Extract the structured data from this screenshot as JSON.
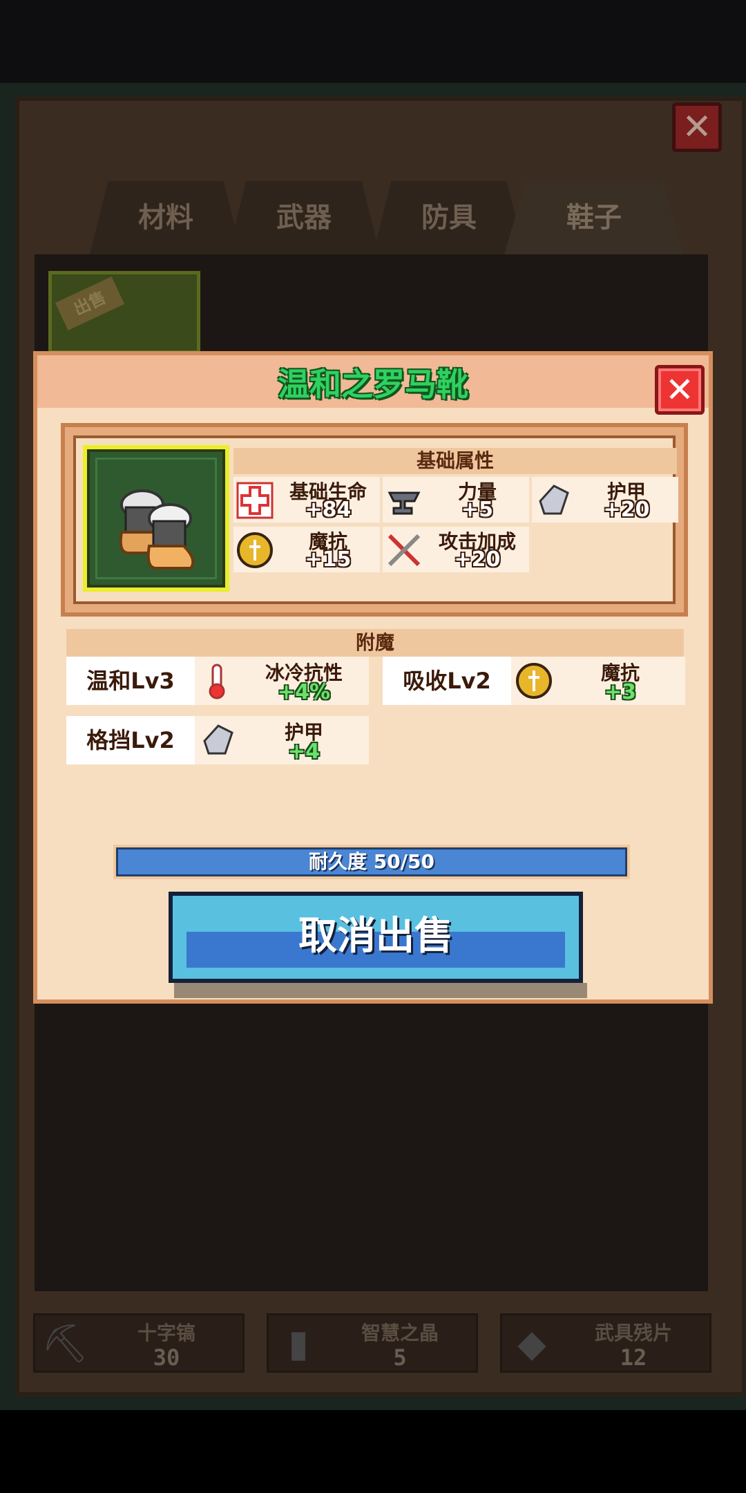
{
  "tabs": [
    "材料",
    "武器",
    "防具",
    "鞋子"
  ],
  "inventory": {
    "sell_tag": "出售"
  },
  "resources": [
    {
      "name": "十字镐",
      "value": "30",
      "icon": "pickaxe-icon"
    },
    {
      "name": "智慧之晶",
      "value": "5",
      "icon": "crystal-icon"
    },
    {
      "name": "武具残片",
      "value": "12",
      "icon": "fragment-icon"
    }
  ],
  "modal": {
    "title": "温和之罗马靴",
    "base_attr_title": "基础属性",
    "attrs": [
      {
        "name": "基础生命",
        "value": "+84",
        "icon": "health-cross-icon"
      },
      {
        "name": "力量",
        "value": "+5",
        "icon": "anvil-icon"
      },
      {
        "name": "护甲",
        "value": "+20",
        "icon": "armor-shard-icon"
      },
      {
        "name": "魔抗",
        "value": "+15",
        "icon": "magic-resist-icon"
      },
      {
        "name": "攻击加成",
        "value": "+20",
        "icon": "crossed-swords-icon"
      }
    ],
    "enchant_title": "附魔",
    "enchants": [
      {
        "name": "温和Lv3",
        "stat": "冰冷抗性",
        "value": "+4%",
        "icon": "thermometer-icon"
      },
      {
        "name": "吸收Lv2",
        "stat": "魔抗",
        "value": "+3",
        "icon": "magic-resist-icon"
      },
      {
        "name": "格挡Lv2",
        "stat": "护甲",
        "value": "+4",
        "icon": "armor-shard-icon"
      }
    ],
    "durability": {
      "label": "耐久度 50/50",
      "current": 50,
      "max": 50
    },
    "button_label": "取消出售"
  },
  "colors": {
    "title_green": "#2fd15e",
    "button_blue": "#3a78cf",
    "close_red": "#e33"
  }
}
